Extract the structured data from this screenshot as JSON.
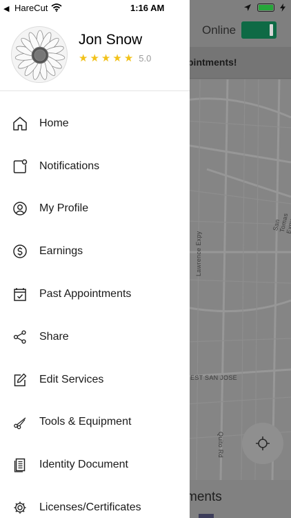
{
  "status_bar": {
    "back_app": "HareCut",
    "time": "1:16 AM"
  },
  "background": {
    "online_label": "Online",
    "banner_text": "pintments!",
    "bottom_text": "ments",
    "map_labels": {
      "lawrence": "Lawrence Expy",
      "san_tomas": "San Tomas Expy",
      "west_san_jose": "EST SAN JOSE",
      "quito": "Quito Rd"
    }
  },
  "profile": {
    "name": "Jon Snow",
    "stars": 5,
    "rating": "5.0"
  },
  "menu": {
    "items": [
      {
        "label": "Home",
        "icon": "home-icon"
      },
      {
        "label": "Notifications",
        "icon": "notification-icon"
      },
      {
        "label": "My Profile",
        "icon": "profile-icon"
      },
      {
        "label": "Earnings",
        "icon": "dollar-icon"
      },
      {
        "label": "Past Appointments",
        "icon": "calendar-check-icon"
      },
      {
        "label": "Share",
        "icon": "share-icon"
      },
      {
        "label": "Edit Services",
        "icon": "edit-icon"
      },
      {
        "label": "Tools & Equipment",
        "icon": "scissors-icon"
      },
      {
        "label": "Identity Document",
        "icon": "document-icon"
      },
      {
        "label": "Licenses/Certificates",
        "icon": "gear-icon"
      }
    ]
  },
  "colors": {
    "accent_star": "#f2c21a",
    "online_toggle": "#0e6a45"
  }
}
